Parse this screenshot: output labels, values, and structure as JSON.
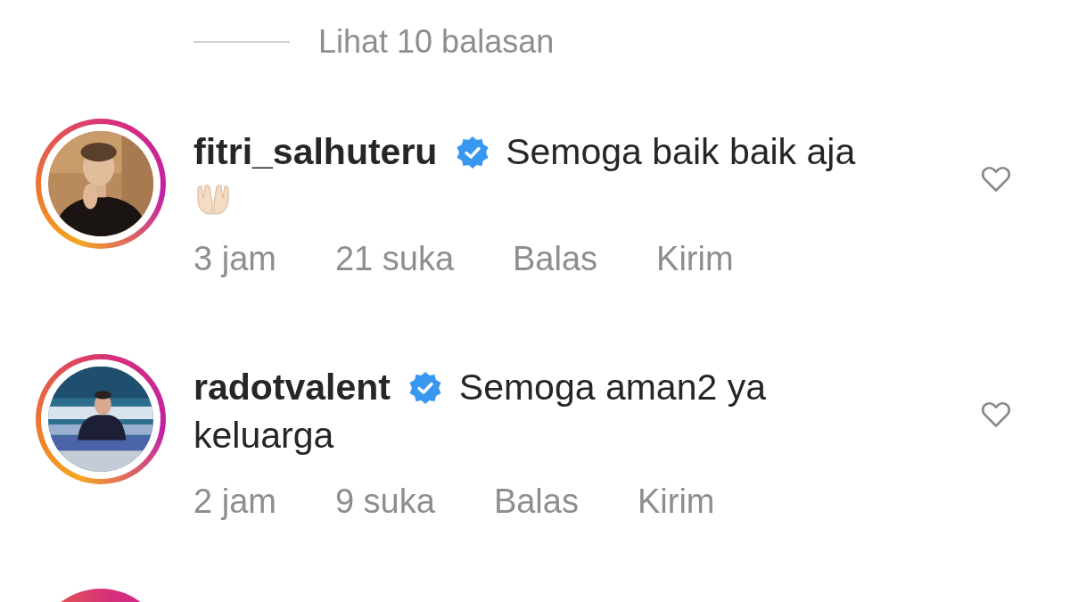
{
  "replies_link": {
    "label": "Lihat 10 balasan"
  },
  "comments": [
    {
      "kind": "comment",
      "story_ring": true,
      "avatar": {
        "kind": "picture"
      },
      "username": "fitri_salhuteru",
      "verified": true,
      "text_lines": [
        "Semoga baik baik aja"
      ],
      "has_emoji": true,
      "time": "3 jam",
      "likes": "21 suka",
      "actions": [
        "Balas",
        "Kirim"
      ],
      "liked": false
    },
    {
      "kind": "comment",
      "story_ring": true,
      "avatar": {
        "kind": "picture"
      },
      "username": "radotvalent",
      "verified": true,
      "text_lines": [
        "Semoga aman2 ya",
        "keluarga"
      ],
      "has_emoji": false,
      "time": "2 jam",
      "likes": "9 suka",
      "actions": [
        "Balas",
        "Kirim"
      ],
      "liked": false
    },
    {
      "kind": "cut-off",
      "story_ring": true
    }
  ]
}
